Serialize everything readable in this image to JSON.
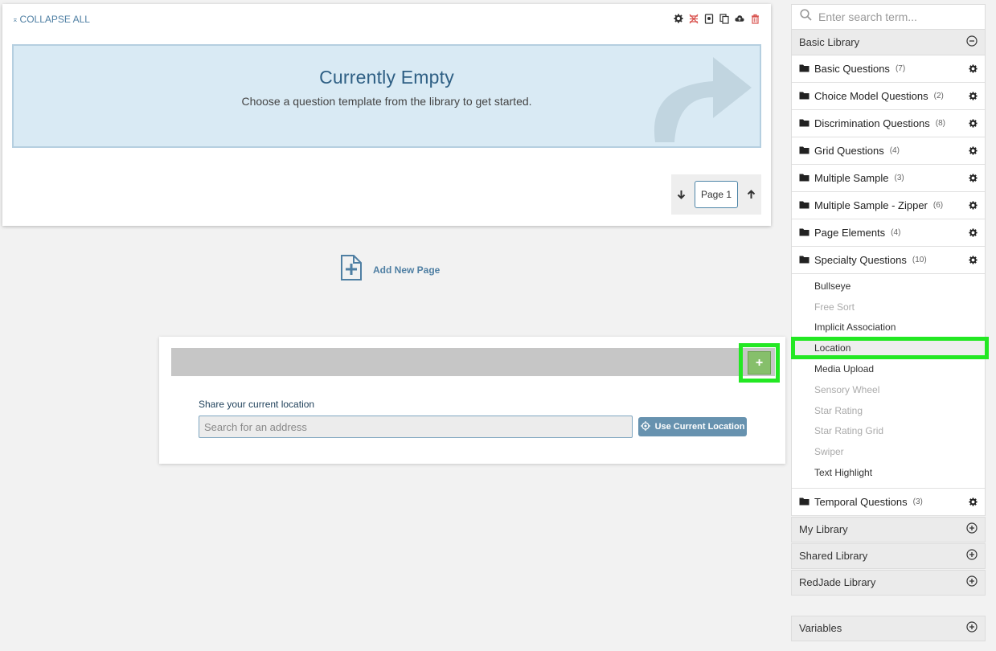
{
  "toolbar": {
    "collapse_all": "COLLAPSE ALL"
  },
  "empty_state": {
    "title": "Currently Empty",
    "subtitle": "Choose a question template from the library to get started."
  },
  "pager": {
    "page_label": "Page 1"
  },
  "add_page": {
    "label": "Add New Page"
  },
  "question": {
    "label": "Share your current location",
    "address_placeholder": "Search for an address",
    "use_location_label": "Use Current Location",
    "add_symbol": "+"
  },
  "sidebar": {
    "search_placeholder": "Enter search term...",
    "basic_library": {
      "title": "Basic Library",
      "folders": [
        {
          "name": "Basic Questions",
          "count": "(7)"
        },
        {
          "name": "Choice Model Questions",
          "count": "(2)"
        },
        {
          "name": "Discrimination Questions",
          "count": "(8)"
        },
        {
          "name": "Grid Questions",
          "count": "(4)"
        },
        {
          "name": "Multiple Sample",
          "count": "(3)"
        },
        {
          "name": "Multiple Sample - Zipper",
          "count": "(6)"
        },
        {
          "name": "Page Elements",
          "count": "(4)"
        },
        {
          "name": "Specialty Questions",
          "count": "(10)"
        }
      ],
      "specialty_items": [
        {
          "label": "Bullseye"
        },
        {
          "label": "Free Sort"
        },
        {
          "label": "Implicit Association"
        },
        {
          "label": "Location"
        },
        {
          "label": "Media Upload"
        },
        {
          "label": "Sensory Wheel"
        },
        {
          "label": "Star Rating"
        },
        {
          "label": "Star Rating Grid"
        },
        {
          "label": "Swiper"
        },
        {
          "label": "Text Highlight"
        }
      ],
      "last_folder": {
        "name": "Temporal Questions",
        "count": "(3)"
      }
    },
    "other_libraries": [
      {
        "title": "My Library"
      },
      {
        "title": "Shared Library"
      },
      {
        "title": "RedJade Library"
      }
    ],
    "variables": {
      "title": "Variables"
    }
  },
  "colors": {
    "highlight": "#23e823",
    "accent": "#4f7fa3",
    "empty_bg": "#d9eaf4"
  }
}
